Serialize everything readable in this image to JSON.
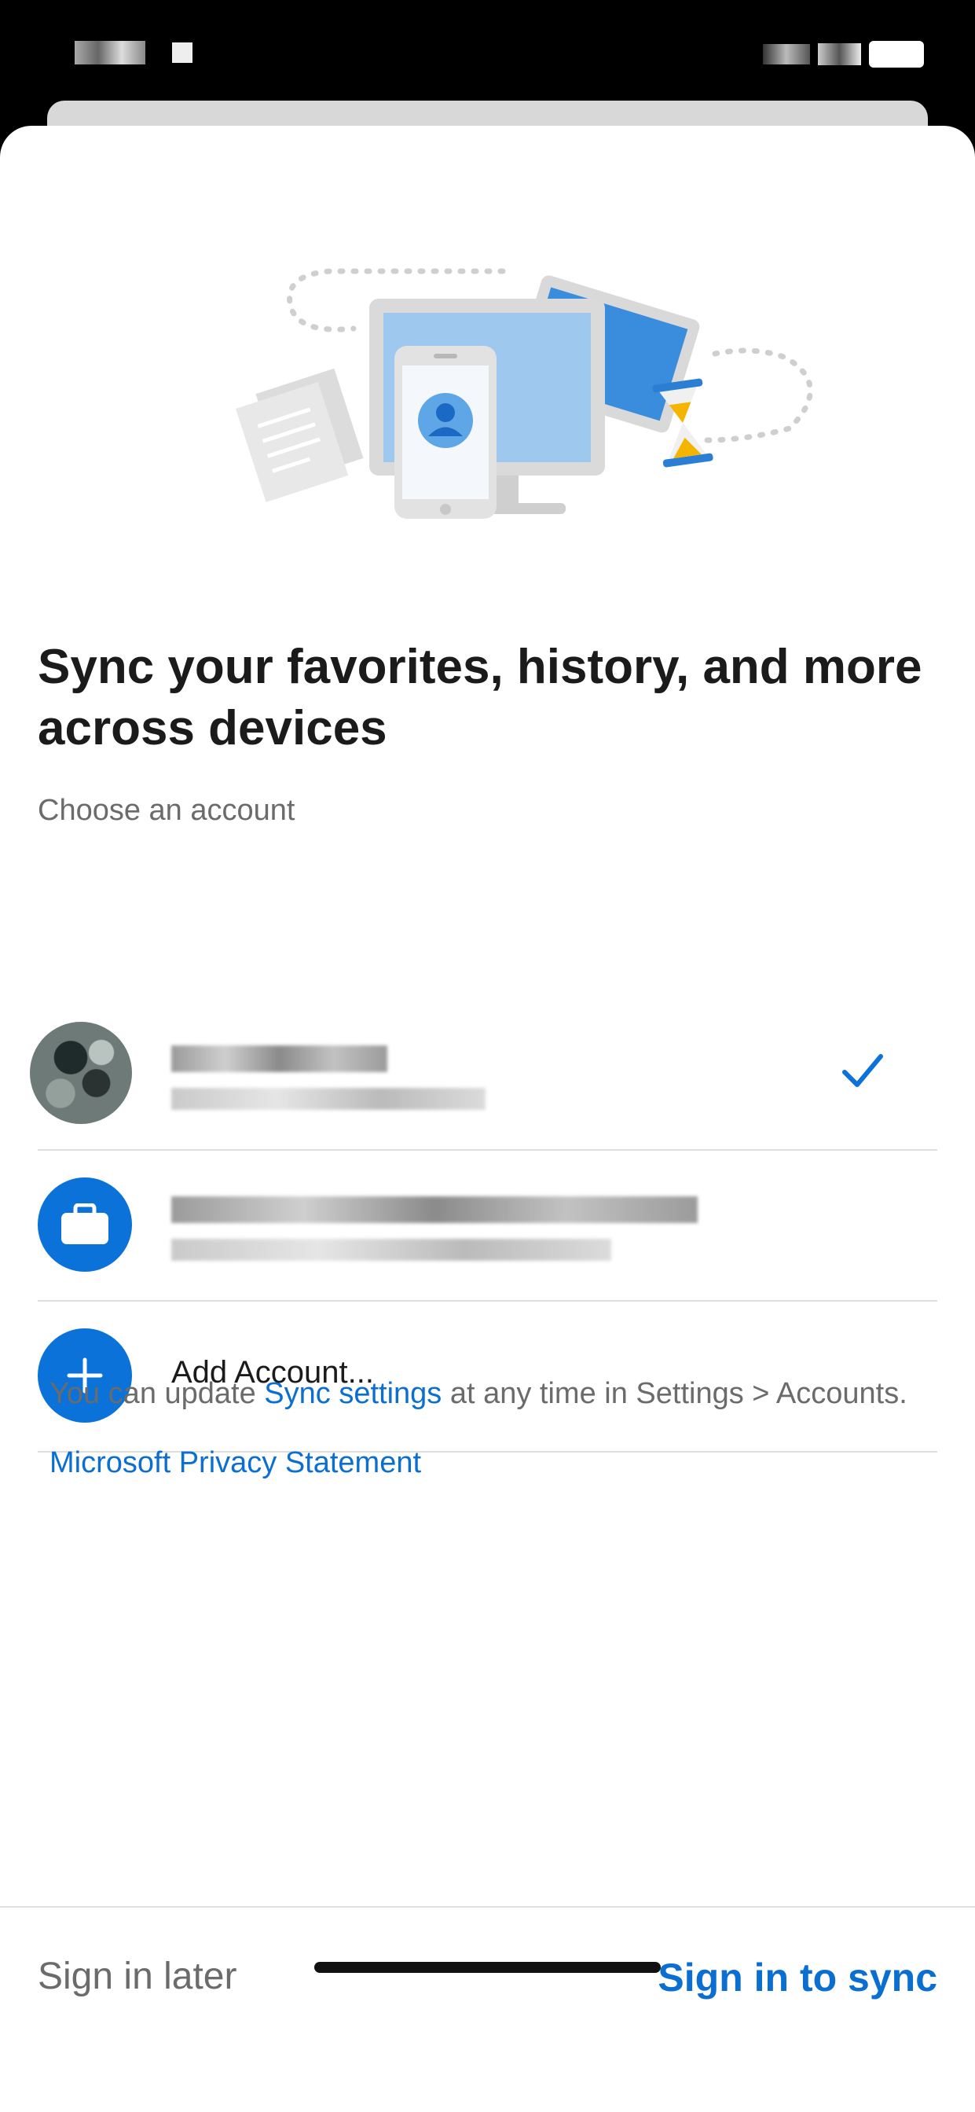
{
  "status_bar": {
    "left_icon": "status-time-pixelated",
    "right_icon": "status-indicators-pixelated"
  },
  "hero": {
    "icon": "devices-sync-illustration"
  },
  "title": "Sync your favorites, history, and more across devices",
  "choose_label": "Choose an account",
  "accounts": [
    {
      "avatar_icon": "profile-photo-blurred",
      "name": "",
      "email": "",
      "selected": true,
      "check_icon": "checkmark-icon"
    },
    {
      "avatar_icon": "briefcase-icon",
      "name": "",
      "email": "",
      "selected": false
    }
  ],
  "add_account": {
    "icon": "plus-icon",
    "label": "Add Account..."
  },
  "note": {
    "prefix": "You can update ",
    "link": "Sync settings",
    "suffix": " at any time in Settings > Accounts."
  },
  "privacy_link": "Microsoft Privacy Statement",
  "footer": {
    "later_label": "Sign in later",
    "sync_label": "Sign in to sync"
  },
  "colors": {
    "accent": "#0a72d8",
    "link": "#0a6fd1",
    "text": "#1b1b1b",
    "muted": "#6b6b6b"
  }
}
